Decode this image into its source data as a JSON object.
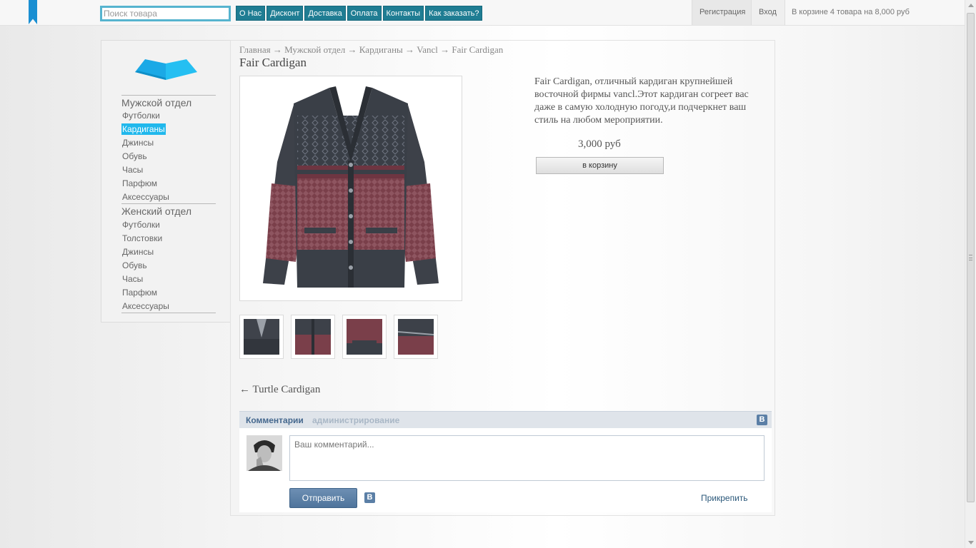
{
  "header": {
    "search_placeholder": "Поиск товара",
    "nav": [
      "О Нас",
      "Дисконт",
      "Доставка",
      "Оплата",
      "Контакты",
      "Как заказать?"
    ],
    "register": "Регистрация",
    "login": "Вход",
    "cart_summary": "В корзине 4 товара на 8,000 руб"
  },
  "sidebar": {
    "men": {
      "title": "Мужской отдел",
      "items": [
        "Футболки",
        "Кардиганы",
        "Джинсы",
        "Обувь",
        "Часы",
        "Парфюм",
        "Аксессуары"
      ],
      "active": "Кардиганы"
    },
    "women": {
      "title": "Женский отдел",
      "items": [
        "Футболки",
        "Толстовки",
        "Джинсы",
        "Обувь",
        "Часы",
        "Парфюм",
        "Аксессуары"
      ]
    }
  },
  "breadcrumbs": [
    "Главная",
    "Мужской отдел",
    "Кардиганы",
    "Vancl",
    "Fair Cardigan"
  ],
  "breadcrumb_separator": " → ",
  "product": {
    "title": "Fair Cardigan",
    "description": "Fair Cardigan, отличный кардиган крупнейшей восточной фирмы vancl.Этот кардиган согреет вас даже в самую холодную погоду,и подчеркнет ваш стиль на любом мероприятии.",
    "price": "3,000 руб",
    "add_to_cart": "в корзину",
    "thumbnails": 4
  },
  "prev_product": "← Turtle Cardigan",
  "comments": {
    "title": "Комментарии",
    "admin": "администрирование",
    "vk_badge": "B",
    "placeholder": "Ваш комментарий...",
    "send": "Отправить",
    "attach": "Прикрепить"
  },
  "colors": {
    "accent_blue": "#21b8ec",
    "nav_teal": "#1f7d93",
    "vk_blue": "#45688e"
  }
}
